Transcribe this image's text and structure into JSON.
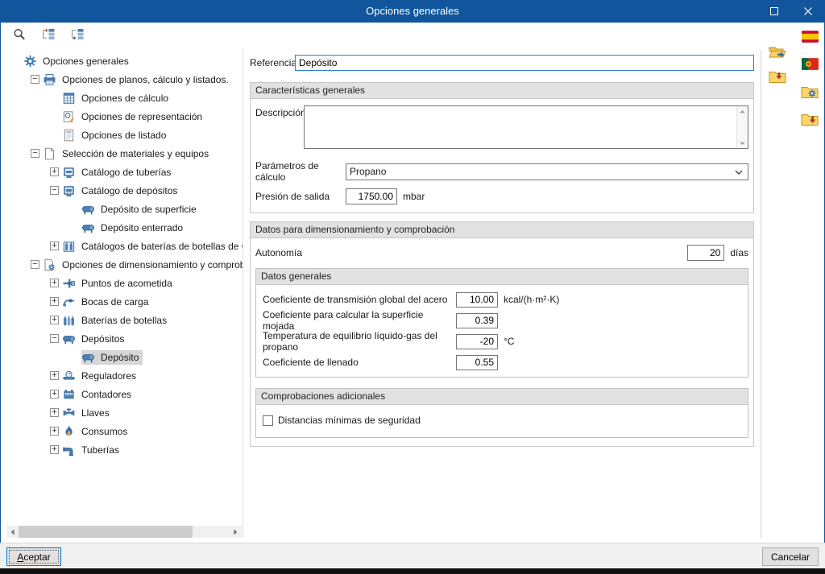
{
  "window": {
    "title": "Opciones generales",
    "controls": [
      {
        "icon": "maximize",
        "name": "maximize-button"
      },
      {
        "icon": "close",
        "name": "close-button"
      }
    ]
  },
  "toolbar": {
    "buttons": [
      {
        "icon": "search",
        "name": "search-button"
      },
      {
        "icon": "tree-collapse",
        "name": "collapse-branch-button"
      },
      {
        "icon": "tree-expand",
        "name": "collapse-all-button"
      }
    ]
  },
  "tree": {
    "items": [
      {
        "label": "Opciones generales",
        "level": 0,
        "expander": "none",
        "icon": "gear",
        "selected": false
      },
      {
        "label": "Opciones de planos, cálculo y listados.",
        "level": 1,
        "expander": "minus",
        "icon": "plans",
        "selected": false
      },
      {
        "label": "Opciones de cálculo",
        "level": 2,
        "expander": "none",
        "icon": "calc",
        "selected": false
      },
      {
        "label": "Opciones de representación",
        "level": 2,
        "expander": "none",
        "icon": "repr",
        "selected": false
      },
      {
        "label": "Opciones de listado",
        "level": 2,
        "expander": "none",
        "icon": "list",
        "selected": false
      },
      {
        "label": "Selección de materiales y equipos",
        "level": 1,
        "expander": "minus",
        "icon": "page",
        "selected": false
      },
      {
        "label": "Catálogo de tuberías",
        "level": 2,
        "expander": "plus",
        "icon": "cat-pipes",
        "selected": false
      },
      {
        "label": "Catálogo de depósitos",
        "level": 2,
        "expander": "minus",
        "icon": "cat-tanks",
        "selected": false
      },
      {
        "label": "Depósito de superficie",
        "level": 3,
        "expander": "none",
        "icon": "tank",
        "selected": false
      },
      {
        "label": "Depósito enterrado",
        "level": 3,
        "expander": "none",
        "icon": "tank",
        "selected": false
      },
      {
        "label": "Catálogos de baterías de botellas de GLP",
        "level": 2,
        "expander": "plus",
        "icon": "bottles",
        "selected": false
      },
      {
        "label": "Opciones de dimensionamiento y comprobación",
        "level": 1,
        "expander": "minus",
        "icon": "dim",
        "selected": false
      },
      {
        "label": "Puntos de acometida",
        "level": 2,
        "expander": "plus",
        "icon": "acometida",
        "selected": false
      },
      {
        "label": "Bocas de carga",
        "level": 2,
        "expander": "plus",
        "icon": "bocas",
        "selected": false
      },
      {
        "label": "Baterías de botellas",
        "level": 2,
        "expander": "plus",
        "icon": "baterias",
        "selected": false
      },
      {
        "label": "Depósitos",
        "level": 2,
        "expander": "minus",
        "icon": "tank",
        "selected": false
      },
      {
        "label": "Depósito",
        "level": 3,
        "expander": "none",
        "icon": "tank",
        "selected": true
      },
      {
        "label": "Reguladores",
        "level": 2,
        "expander": "plus",
        "icon": "reg",
        "selected": false
      },
      {
        "label": "Contadores",
        "level": 2,
        "expander": "plus",
        "icon": "cont",
        "selected": false
      },
      {
        "label": "Llaves",
        "level": 2,
        "expander": "plus",
        "icon": "llaves",
        "selected": false
      },
      {
        "label": "Consumos",
        "level": 2,
        "expander": "plus",
        "icon": "consumos",
        "selected": false
      },
      {
        "label": "Tuberías",
        "level": 2,
        "expander": "plus",
        "icon": "tuberias",
        "selected": false
      }
    ]
  },
  "form": {
    "referencia": {
      "label": "Referencia",
      "value": "Depósito"
    },
    "caracteristicas": {
      "header": "Características generales",
      "descripcion_label": "Descripción",
      "parametros_label": "Parámetros de cálculo",
      "parametros_value": "Propano",
      "presion_label": "Presión de salida",
      "presion_value": "1750.00",
      "presion_unit": "mbar"
    },
    "datos": {
      "header": "Datos para dimensionamiento y comprobación",
      "autonomia_label": "Autonomía",
      "autonomia_value": "20",
      "autonomia_unit": "días",
      "datos_generales": {
        "header": "Datos generales",
        "rows": [
          {
            "label": "Coeficiente de transmisión global del acero",
            "value": "10.00",
            "unit": "kcal/(h·m²·K)"
          },
          {
            "label": "Coeficiente para calcular la superficie mojada",
            "value": "0.39",
            "unit": ""
          },
          {
            "label": "Temperatura de equilibrio líquido-gas del propano",
            "value": "-20",
            "unit": "°C"
          },
          {
            "label": "Coeficiente de llenado",
            "value": "0.55",
            "unit": ""
          }
        ]
      },
      "comprobaciones": {
        "header": "Comprobaciones adicionales",
        "checkbox_label": "Distancias mínimas de seguridad",
        "checkbox_checked": false
      }
    }
  },
  "side_toolbar": {
    "buttons": [
      {
        "icon": "folder-open",
        "name": "import-options-button"
      },
      {
        "icon": "folder-save",
        "name": "export-options-button"
      }
    ]
  },
  "far_toolbar": {
    "buttons": [
      {
        "icon": "spain-flag",
        "name": "spain-flag-button"
      },
      {
        "icon": "portugal-flag",
        "name": "portugal-flag-button"
      },
      {
        "icon": "folder-gear",
        "name": "config-folder-button"
      },
      {
        "icon": "folder-import",
        "name": "install-options-button"
      }
    ]
  },
  "footer": {
    "accept_accel": "A",
    "accept_rest": "ceptar",
    "cancel": "Cancelar"
  }
}
